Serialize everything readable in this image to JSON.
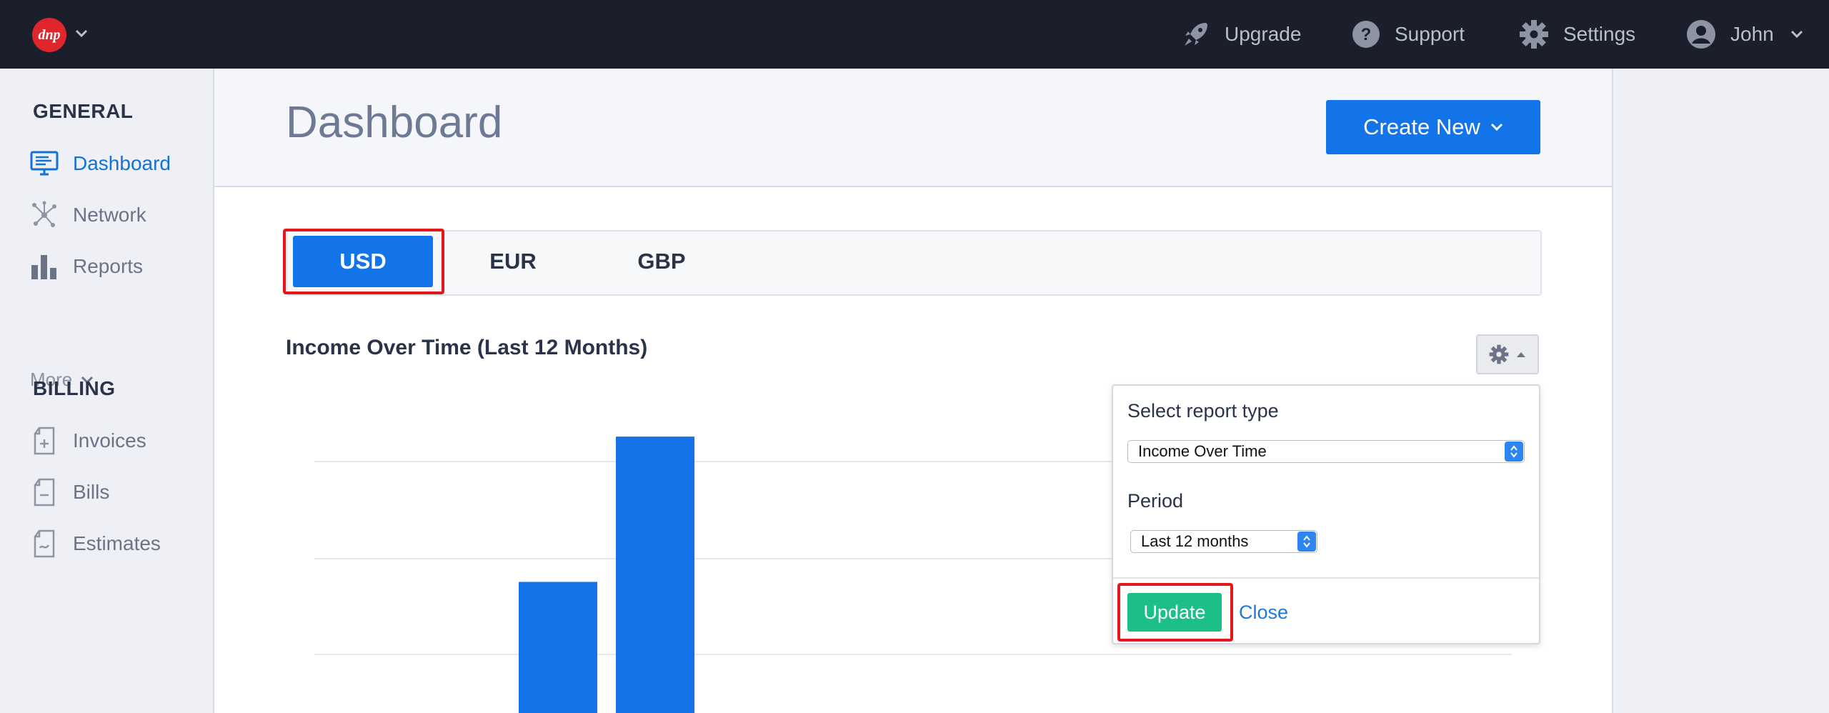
{
  "topbar": {
    "logo_text": "dnp",
    "upgrade": "Upgrade",
    "support": "Support",
    "settings": "Settings",
    "user": "John"
  },
  "sidebar": {
    "general_title": "GENERAL",
    "general_items": [
      {
        "label": "Dashboard",
        "icon": "monitor-icon",
        "active": true
      },
      {
        "label": "Network",
        "icon": "network-icon",
        "active": false
      },
      {
        "label": "Reports",
        "icon": "bar-chart-icon",
        "active": false
      }
    ],
    "more": "More",
    "billing_title": "BILLING",
    "billing_items": [
      {
        "label": "Invoices",
        "icon": "invoice-icon"
      },
      {
        "label": "Bills",
        "icon": "bill-icon"
      },
      {
        "label": "Estimates",
        "icon": "estimate-icon"
      }
    ]
  },
  "header": {
    "title": "Dashboard",
    "create_new": "Create New"
  },
  "currency_tabs": [
    {
      "label": "USD",
      "active": true
    },
    {
      "label": "EUR",
      "active": false
    },
    {
      "label": "GBP",
      "active": false
    }
  ],
  "report": {
    "title": "Income Over Time (Last 12 Months)"
  },
  "settings_panel": {
    "report_type_label": "Select report type",
    "report_type_value": "Income Over Time",
    "period_label": "Period",
    "period_value": "Last 12 months",
    "update": "Update",
    "close": "Close"
  },
  "chart_data": {
    "type": "bar",
    "visible_bar_heights_relative": [
      0.37,
      0.78
    ],
    "bar_color": "#1274e8",
    "grid": true
  },
  "colors": {
    "accent": "#1274e8",
    "highlight": "#e3171c",
    "success": "#1cbf85",
    "topbar": "#1b1f2b"
  }
}
